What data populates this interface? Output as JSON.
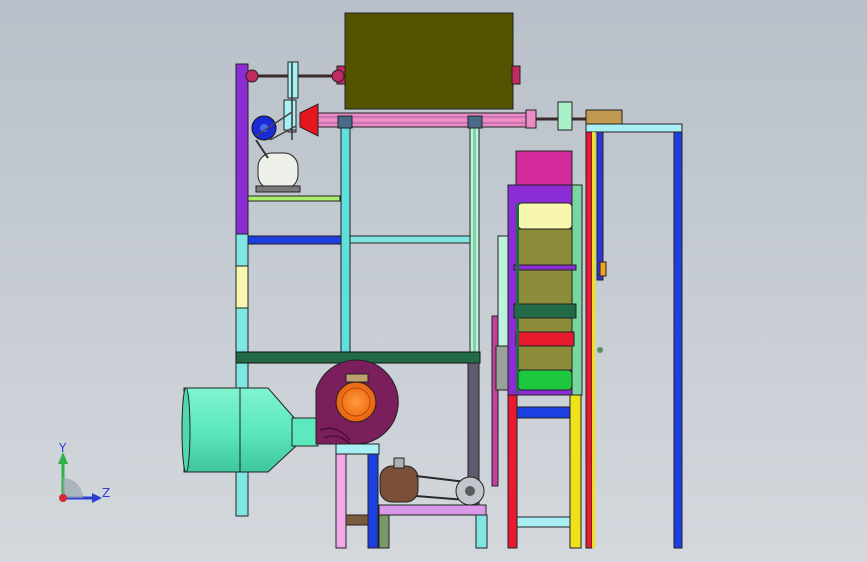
{
  "viewport": {
    "background_top": "#b9c0c9",
    "background_bottom": "#d4d8dd"
  },
  "triad": {
    "y_label": "Y",
    "z_label": "Z",
    "y_color": "#2fb24a",
    "z_color": "#2c3dd4",
    "x_color": "#d22a2a"
  },
  "colors": {
    "hopper": "#545400",
    "screw_tube": "#e98cc6",
    "frame_cyan": "#5ee0dc",
    "frame_purple": "#8c2cd4",
    "bar_blue": "#1b3fe0",
    "bar_green_dark": "#226b46",
    "fan_housing": "#7a1e5c",
    "fan_rotor": "#f47c1e",
    "duct": "#5ee8be",
    "motor_white": "#eef0ea",
    "motor_brown": "#7a5038",
    "magenta_block": "#d22a9c",
    "yellow_block": "#f7f7b0",
    "olive_block": "#8c8c3a",
    "red_frame": "#e81a2e",
    "yellow_frame": "#f0e21a",
    "pink_frame": "#f4a8e8",
    "light_cyan": "#a8f0f4",
    "green_leg": "#7ad6a0",
    "grey_leg": "#5f5a6e",
    "lime": "#a8ee6a",
    "blue_roll": "#1a4ad6",
    "green_roll": "#1ec83e"
  }
}
